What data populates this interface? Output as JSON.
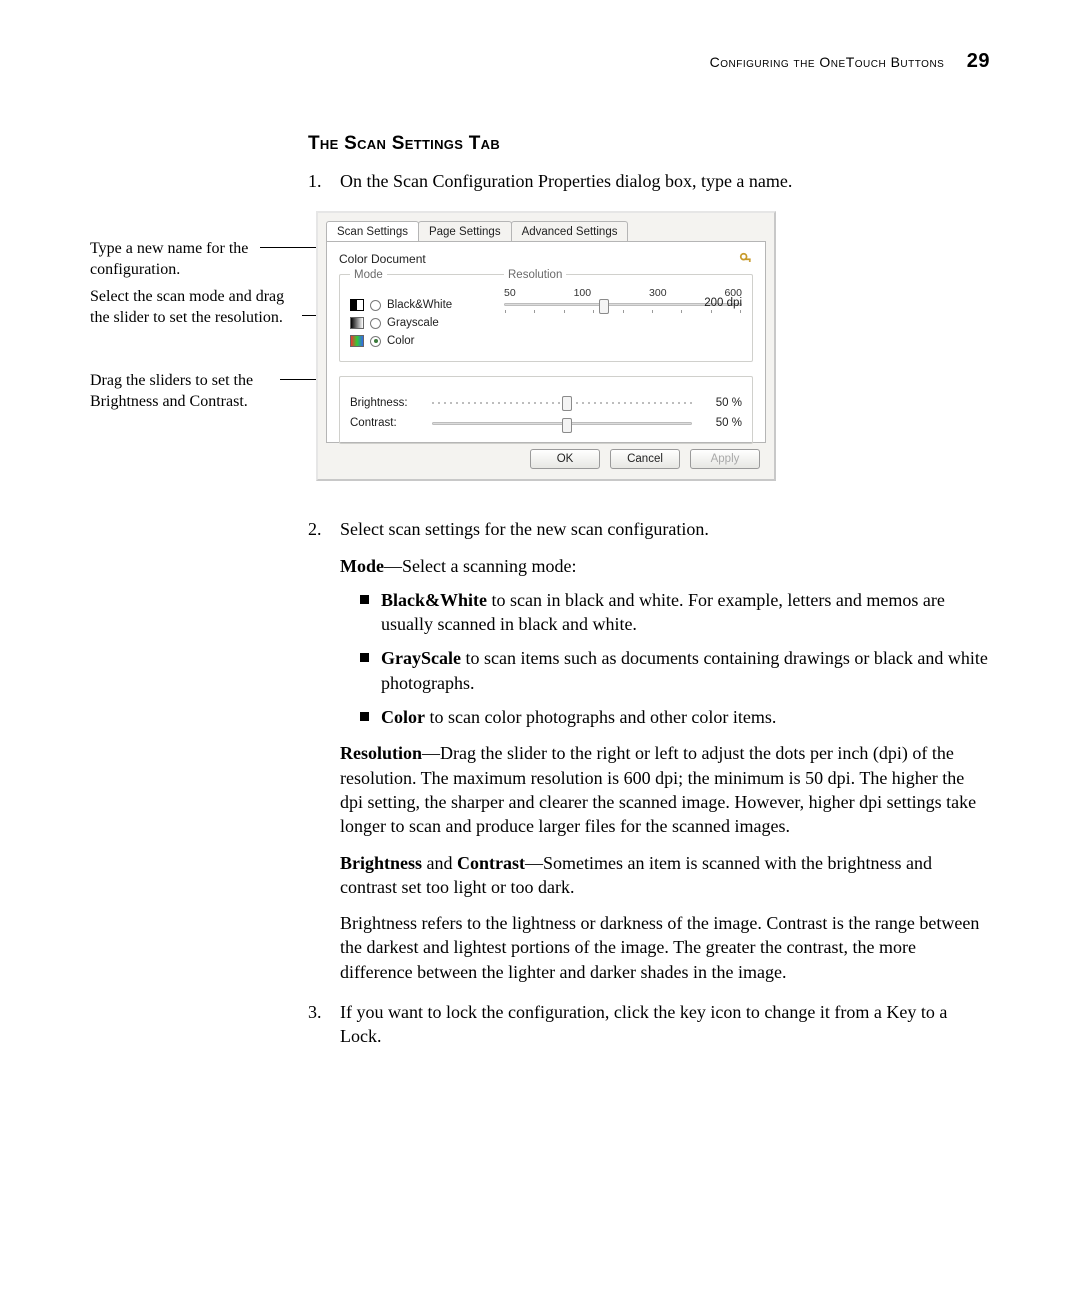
{
  "header": {
    "chapter": "Configuring the OneTouch Buttons",
    "page": "29"
  },
  "section_title": "The Scan Settings Tab",
  "step1": {
    "num": "1.",
    "text": "On the Scan Configuration Properties dialog box, type a name."
  },
  "callouts": {
    "c1": "Type a new name for the configuration.",
    "c2": "Select the scan mode and drag the slider to set the resolution.",
    "c3": "Drag the sliders to set the Brightness and Contrast."
  },
  "dialog": {
    "tabs": {
      "t1": "Scan Settings",
      "t2": "Page Settings",
      "t3": "Advanced Settings"
    },
    "config_name": "Color Document",
    "mode_label": "Mode",
    "resolution_label": "Resolution",
    "modes": {
      "bw": "Black&White",
      "gray": "Grayscale",
      "color": "Color"
    },
    "res_ticks": {
      "a": "50",
      "b": "100",
      "c": "300",
      "d": "600"
    },
    "res_value": "200 dpi",
    "brightness_label": "Brightness:",
    "contrast_label": "Contrast:",
    "brightness_value": "50 %",
    "contrast_value": "50 %",
    "buttons": {
      "ok": "OK",
      "cancel": "Cancel",
      "apply": "Apply"
    }
  },
  "step2": {
    "num": "2.",
    "text": "Select scan settings for the new scan configuration.",
    "mode_para_strong": "Mode",
    "mode_para_rest": "—Select a scanning mode:",
    "bullets": {
      "bw_strong": "Black&White",
      "bw_rest": " to scan in black and white. For example, letters and memos are usually scanned in black and white.",
      "gray_strong": "GrayScale",
      "gray_rest": " to scan items such as documents containing drawings or black and white photographs.",
      "color_strong": "Color",
      "color_rest": " to scan color photographs and other color items."
    },
    "res_strong": "Resolution",
    "res_rest": "—Drag the slider to the right or left to adjust the dots per inch (dpi) of the resolution. The maximum resolution is 600 dpi; the minimum is 50 dpi. The higher the dpi setting, the sharper and clearer the scanned image. However, higher dpi settings take longer to scan and produce larger files for the scanned images.",
    "bc_strong1": "Brightness",
    "bc_mid": " and ",
    "bc_strong2": "Contrast",
    "bc_rest": "—Sometimes an item is scanned with the brightness and contrast set too light or too dark.",
    "bc_para2": "Brightness refers to the lightness or darkness of the image. Contrast is the range between the darkest and lightest portions of the image. The greater the contrast, the more difference between the lighter and darker shades in the image."
  },
  "step3": {
    "num": "3.",
    "text": "If you want to lock the configuration, click the key icon to change it from a Key to a Lock."
  }
}
